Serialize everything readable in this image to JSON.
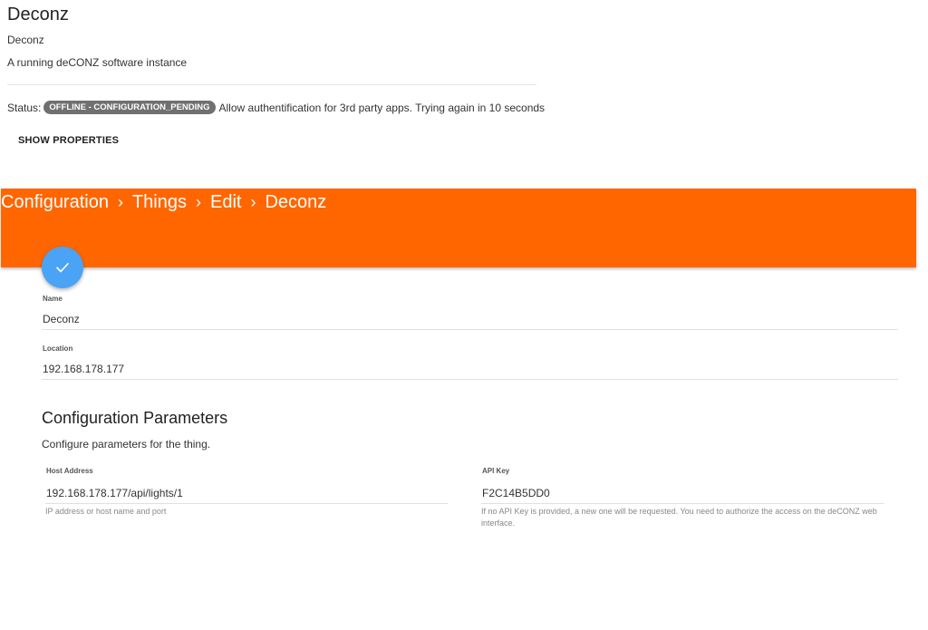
{
  "thing": {
    "title": "Deconz",
    "label": "Deconz",
    "description": "A running deCONZ software instance",
    "status_prefix": "Status:",
    "status_badge": "OFFLINE - CONFIGURATION_PENDING",
    "status_detail": "Allow authentification for 3rd party apps. Trying again in 10 seconds",
    "show_properties": "SHOW PROPERTIES"
  },
  "header": {
    "background_color": "#ff6600",
    "breadcrumb": [
      "Configuration",
      "Things",
      "Edit",
      "Deconz"
    ],
    "separator": "›"
  },
  "fab": {
    "icon": "check-icon",
    "color": "#4aa3f5"
  },
  "form": {
    "name": {
      "label": "Name",
      "value": "Deconz"
    },
    "location": {
      "label": "Location",
      "value": "192.168.178.177"
    }
  },
  "config": {
    "title": "Configuration Parameters",
    "description": "Configure parameters for the thing.",
    "host": {
      "label": "Host Address",
      "value": "192.168.178.177/api/lights/1",
      "hint": "IP address or host name and port"
    },
    "api_key": {
      "label": "API Key",
      "value": "F2C14B5DD0",
      "hint": "If no API Key is provided, a new one will be requested. You need to authorize the access on the deCONZ web interface."
    }
  }
}
